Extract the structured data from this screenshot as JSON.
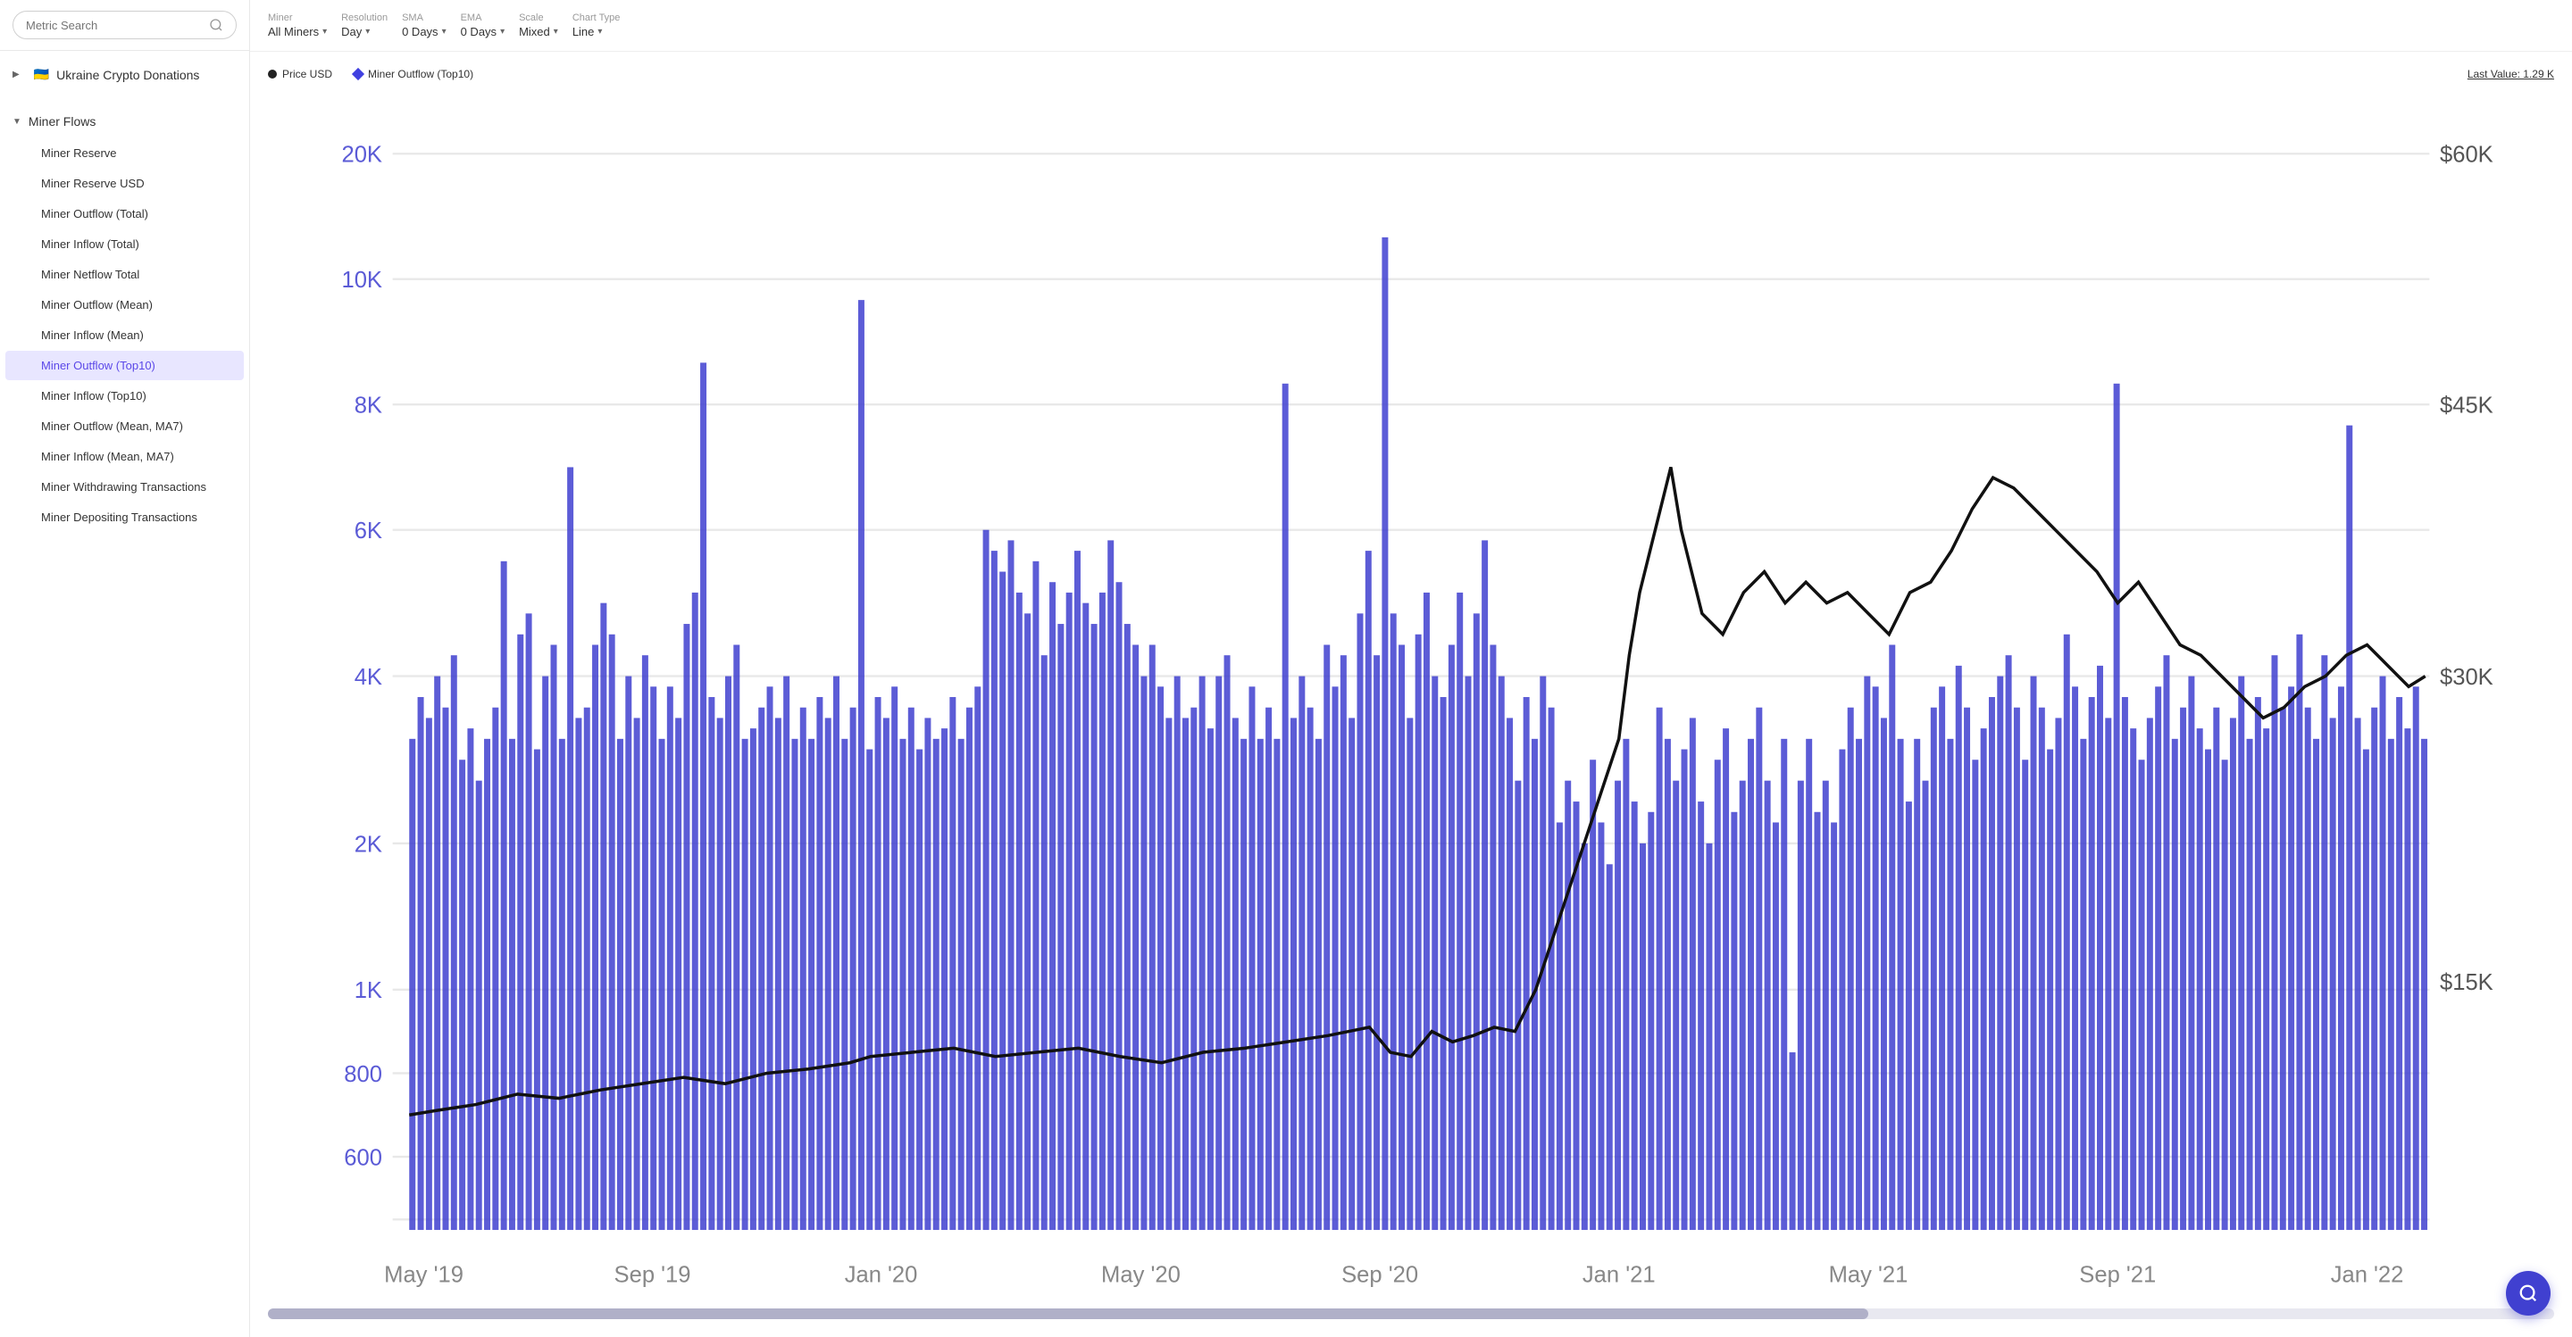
{
  "sidebar": {
    "search_placeholder": "Metric Search",
    "ukraine_section": {
      "label": "Ukraine Crypto Donations",
      "flag": "🇺🇦",
      "arrow": "▶"
    },
    "miner_flows_section": {
      "label": "Miner Flows",
      "arrow": "▼",
      "items": [
        {
          "label": "Miner Reserve",
          "active": false
        },
        {
          "label": "Miner Reserve USD",
          "active": false
        },
        {
          "label": "Miner Outflow (Total)",
          "active": false
        },
        {
          "label": "Miner Inflow (Total)",
          "active": false
        },
        {
          "label": "Miner Netflow Total",
          "active": false
        },
        {
          "label": "Miner Outflow (Mean)",
          "active": false
        },
        {
          "label": "Miner Inflow (Mean)",
          "active": false
        },
        {
          "label": "Miner Outflow (Top10)",
          "active": true
        },
        {
          "label": "Miner Inflow (Top10)",
          "active": false
        },
        {
          "label": "Miner Outflow (Mean, MA7)",
          "active": false
        },
        {
          "label": "Miner Inflow (Mean, MA7)",
          "active": false
        },
        {
          "label": "Miner Withdrawing Transactions",
          "active": false
        },
        {
          "label": "Miner Depositing Transactions",
          "active": false
        }
      ]
    }
  },
  "toolbar": {
    "miner": {
      "label": "Miner",
      "value": "All Miners"
    },
    "resolution": {
      "label": "Resolution",
      "value": "Day"
    },
    "sma": {
      "label": "SMA",
      "value": "0 Days"
    },
    "ema": {
      "label": "EMA",
      "value": "0 Days"
    },
    "scale": {
      "label": "Scale",
      "value": "Mixed"
    },
    "chart_type": {
      "label": "Chart Type",
      "value": "Line"
    }
  },
  "legend": {
    "price_label": "Price USD",
    "outflow_label": "Miner Outflow (Top10)",
    "last_value": "Last Value: 1.29 K"
  },
  "chart": {
    "y_left": [
      "20K",
      "10K",
      "8K",
      "6K",
      "4K",
      "2K",
      "1K",
      "800",
      "600"
    ],
    "y_right": [
      "$60K",
      "$45K",
      "$30K",
      "$15K"
    ],
    "x_labels": [
      "May '19",
      "Sep '19",
      "Jan '20",
      "May '20",
      "Sep '20",
      "Jan '21",
      "May '21",
      "Sep '21",
      "Jan '22"
    ]
  },
  "fab": {
    "icon": "search"
  }
}
